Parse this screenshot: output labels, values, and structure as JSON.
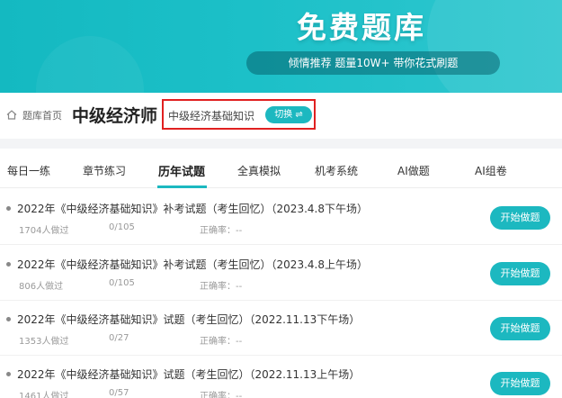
{
  "banner": {
    "title": "免费题库",
    "slogan": "倾情推荐 题量10W+ 带你花式刷题"
  },
  "header": {
    "breadcrumb": "题库首页",
    "title": "中级经济师",
    "subject": "中级经济基础知识",
    "switch_label": "切换 ⇌"
  },
  "tabs": [
    "每日一练",
    "章节练习",
    "历年试题",
    "全真模拟",
    "机考系统",
    "AI做题",
    "AI组卷"
  ],
  "active_tab": "历年试题",
  "rows": [
    {
      "title": "2022年《中级经济基础知识》补考试题（考生回忆）（2023.4.8下午场）",
      "done": "1704人做过",
      "progress": "0/105",
      "accuracy": "正确率：--",
      "button": "开始做题"
    },
    {
      "title": "2022年《中级经济基础知识》补考试题（考生回忆）（2023.4.8上午场）",
      "done": "806人做过",
      "progress": "0/105",
      "accuracy": "正确率：--",
      "button": "开始做题"
    },
    {
      "title": "2022年《中级经济基础知识》试题（考生回忆）（2022.11.13下午场）",
      "done": "1353人做过",
      "progress": "0/27",
      "accuracy": "正确率：--",
      "button": "开始做题"
    },
    {
      "title": "2022年《中级经济基础知识》试题（考生回忆）（2022.11.13上午场）",
      "done": "1461人做过",
      "progress": "0/57",
      "accuracy": "正确率：--",
      "button": "开始做题"
    }
  ],
  "colors": {
    "accent": "#1cb8c0",
    "highlight_border": "#e02020"
  }
}
